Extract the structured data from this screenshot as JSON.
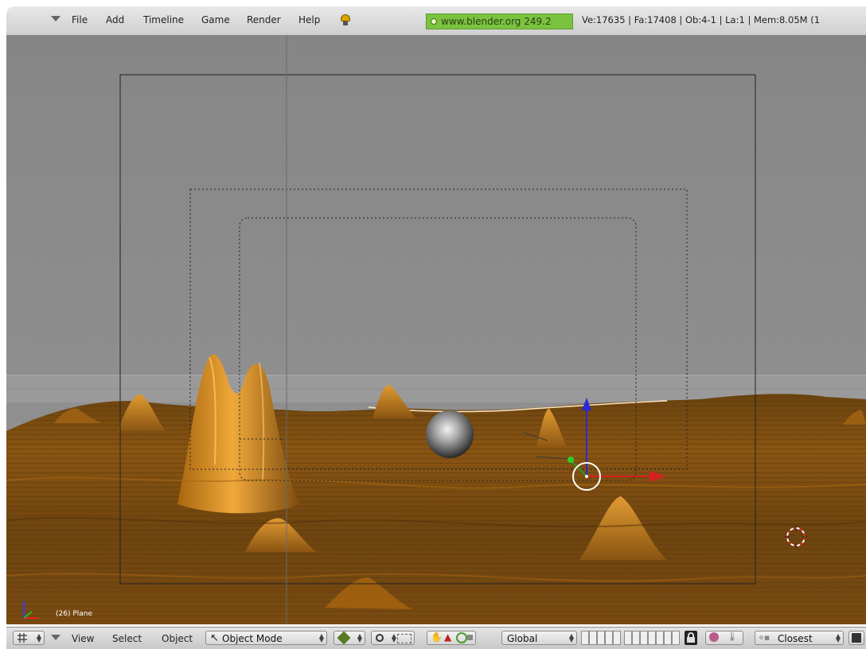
{
  "header": {
    "menus": [
      "File",
      "Add",
      "Timeline",
      "Game",
      "Render",
      "Help"
    ],
    "site_version": "www.blender.org 249.2",
    "stats": "Ve:17635 | Fa:17408 | Ob:4-1 | La:1  | Mem:8.05M (1"
  },
  "viewport": {
    "object_label": "(26) Plane"
  },
  "toolbar": {
    "menus": [
      "View",
      "Select",
      "Object"
    ],
    "mode": "Object Mode",
    "orientation": "Global",
    "snap": "Closest"
  },
  "colors": {
    "sky": "#8c8c8c",
    "terrain": "#b87418",
    "header_bg": "#d9d9d9",
    "site_chip": "#7bc33f"
  }
}
